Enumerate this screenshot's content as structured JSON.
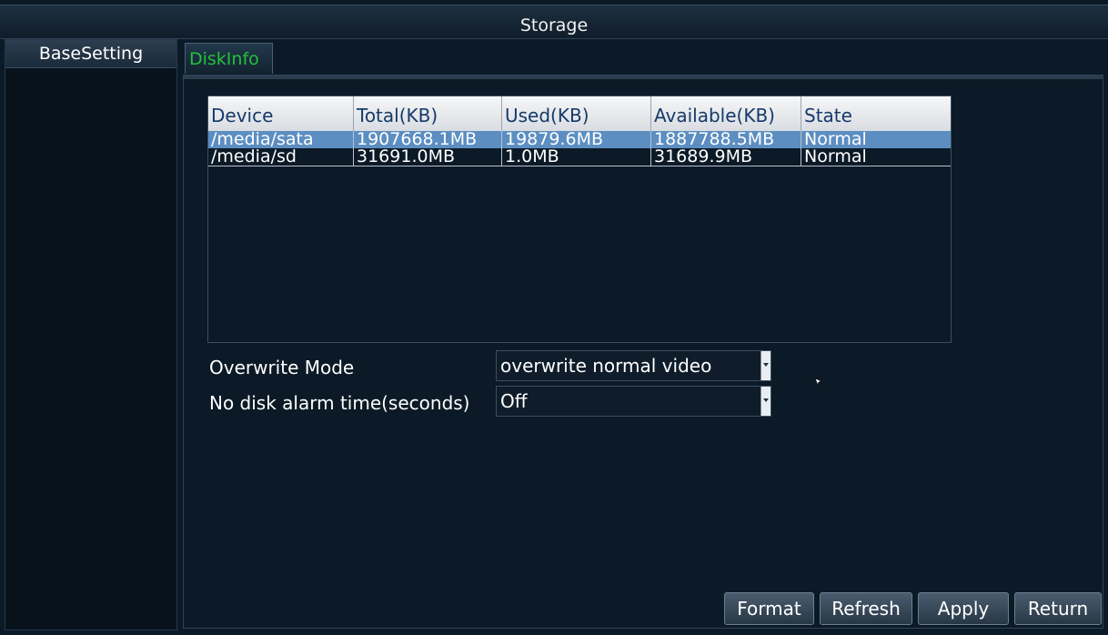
{
  "window": {
    "title": "Storage"
  },
  "sidebar": {
    "items": [
      {
        "label": "BaseSetting"
      }
    ]
  },
  "tabs": [
    {
      "label": "DiskInfo",
      "active": true
    }
  ],
  "disk_table": {
    "columns": [
      "Device",
      "Total(KB)",
      "Used(KB)",
      "Available(KB)",
      "State"
    ],
    "rows": [
      {
        "device": "/media/sata",
        "total": "1907668.1MB",
        "used": "19879.6MB",
        "available": "1887788.5MB",
        "state": "Normal",
        "selected": true
      },
      {
        "device": "/media/sd",
        "total": "31691.0MB",
        "used": "1.0MB",
        "available": "31689.9MB",
        "state": "Normal",
        "selected": false
      }
    ]
  },
  "settings": {
    "overwrite_mode": {
      "label": "Overwrite Mode",
      "value": "overwrite normal video"
    },
    "no_disk_alarm": {
      "label": "No disk alarm time(seconds)",
      "value": "Off"
    }
  },
  "buttons": {
    "format": "Format",
    "refresh": "Refresh",
    "apply": "Apply",
    "return": "Return"
  },
  "colors": {
    "accent_tab_text": "#22c13a",
    "selection": "#5c8ec2",
    "background": "#0b1a26"
  }
}
